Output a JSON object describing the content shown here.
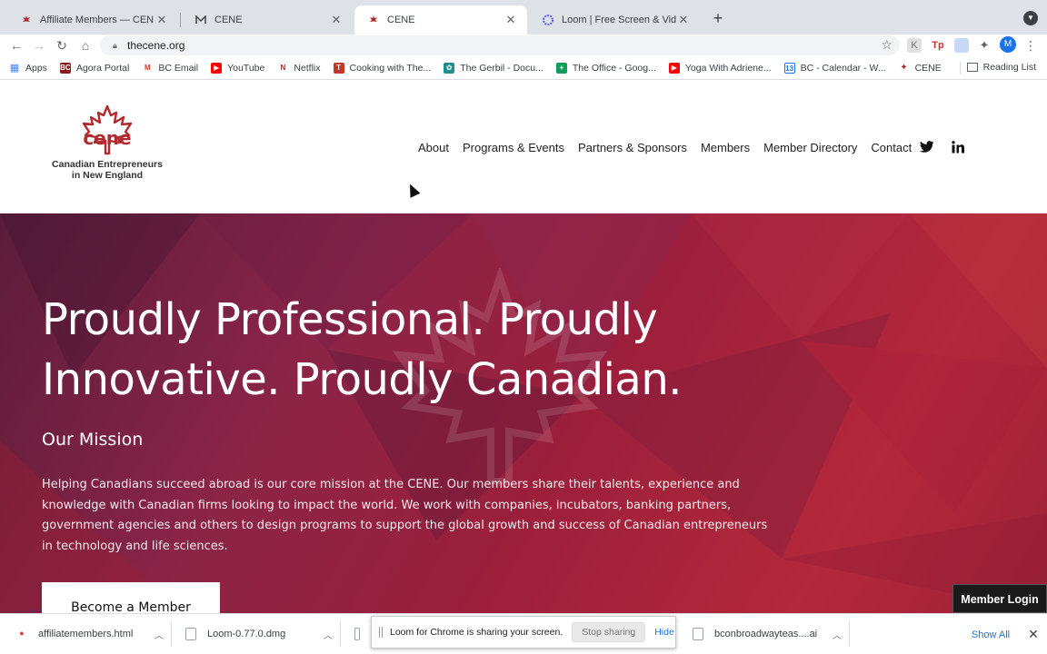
{
  "browser": {
    "tabs": [
      {
        "title": "Affiliate Members — CENE",
        "active": false
      },
      {
        "title": "CENE",
        "active": false
      },
      {
        "title": "CENE",
        "active": true
      },
      {
        "title": "Loom | Free Screen & Video Re",
        "active": false
      }
    ],
    "new_tab": "+",
    "url": "thecene.org",
    "profile_initial": "M",
    "bookmarks": [
      {
        "label": "Apps",
        "icon": "apps-grid-icon",
        "color": "#4285f4"
      },
      {
        "label": "Agora Portal",
        "icon": "bc-icon",
        "color": "#8b1a1a"
      },
      {
        "label": "BC Email",
        "icon": "gmail-icon",
        "color": "#d93025"
      },
      {
        "label": "YouTube",
        "icon": "youtube-icon",
        "color": "#ff0000"
      },
      {
        "label": "Netflix",
        "icon": "netflix-icon",
        "color": "#e50914"
      },
      {
        "label": "Cooking with The...",
        "icon": "nyt-cooking-icon",
        "color": "#c0392b"
      },
      {
        "label": "The Gerbil - Docu...",
        "icon": "docs-icon",
        "color": "#1e8e8e"
      },
      {
        "label": "The Office - Goog...",
        "icon": "sheets-icon",
        "color": "#0f9d58"
      },
      {
        "label": "Yoga With Adriene...",
        "icon": "youtube-icon",
        "color": "#ff0000"
      },
      {
        "label": "BC - Calendar - W...",
        "icon": "calendar-icon",
        "color": "#1a73e8"
      },
      {
        "label": "CENE",
        "icon": "cene-icon",
        "color": "#b22a2e"
      }
    ],
    "reading_list": "Reading List"
  },
  "site": {
    "logo": {
      "wordmark": "cene",
      "tagline_line1": "Canadian Entrepreneurs",
      "tagline_line2": "in New England"
    },
    "nav": [
      "About",
      "Programs & Events",
      "Partners & Sponsors",
      "Members",
      "Member Directory",
      "Contact"
    ],
    "hero": {
      "headline": "Proudly Professional. Proudly Innovative. Proudly Canadian.",
      "subheading": "Our Mission",
      "body": "Helping Canadians succeed abroad is our core mission at the CENE. Our members share their talents, experience and knowledge with Canadian firms looking to impact the world. We work with companies, incubators, banking partners, government agencies and others to design programs to support the global growth and success of Canadian entrepreneurs in technology and life sciences.",
      "cta": "Become a Member"
    },
    "member_login": "Member Login",
    "brand_color": "#b22a2e"
  },
  "downloads": {
    "items": [
      {
        "name": "affiliatemembers.html"
      },
      {
        "name": "Loom-0.77.0.dmg"
      },
      {
        "name": "bconbroadwayteas....ai"
      }
    ],
    "show_all": "Show All"
  },
  "share_banner": {
    "message": "Loom for Chrome is sharing your screen.",
    "stop": "Stop sharing",
    "hide": "Hide"
  }
}
